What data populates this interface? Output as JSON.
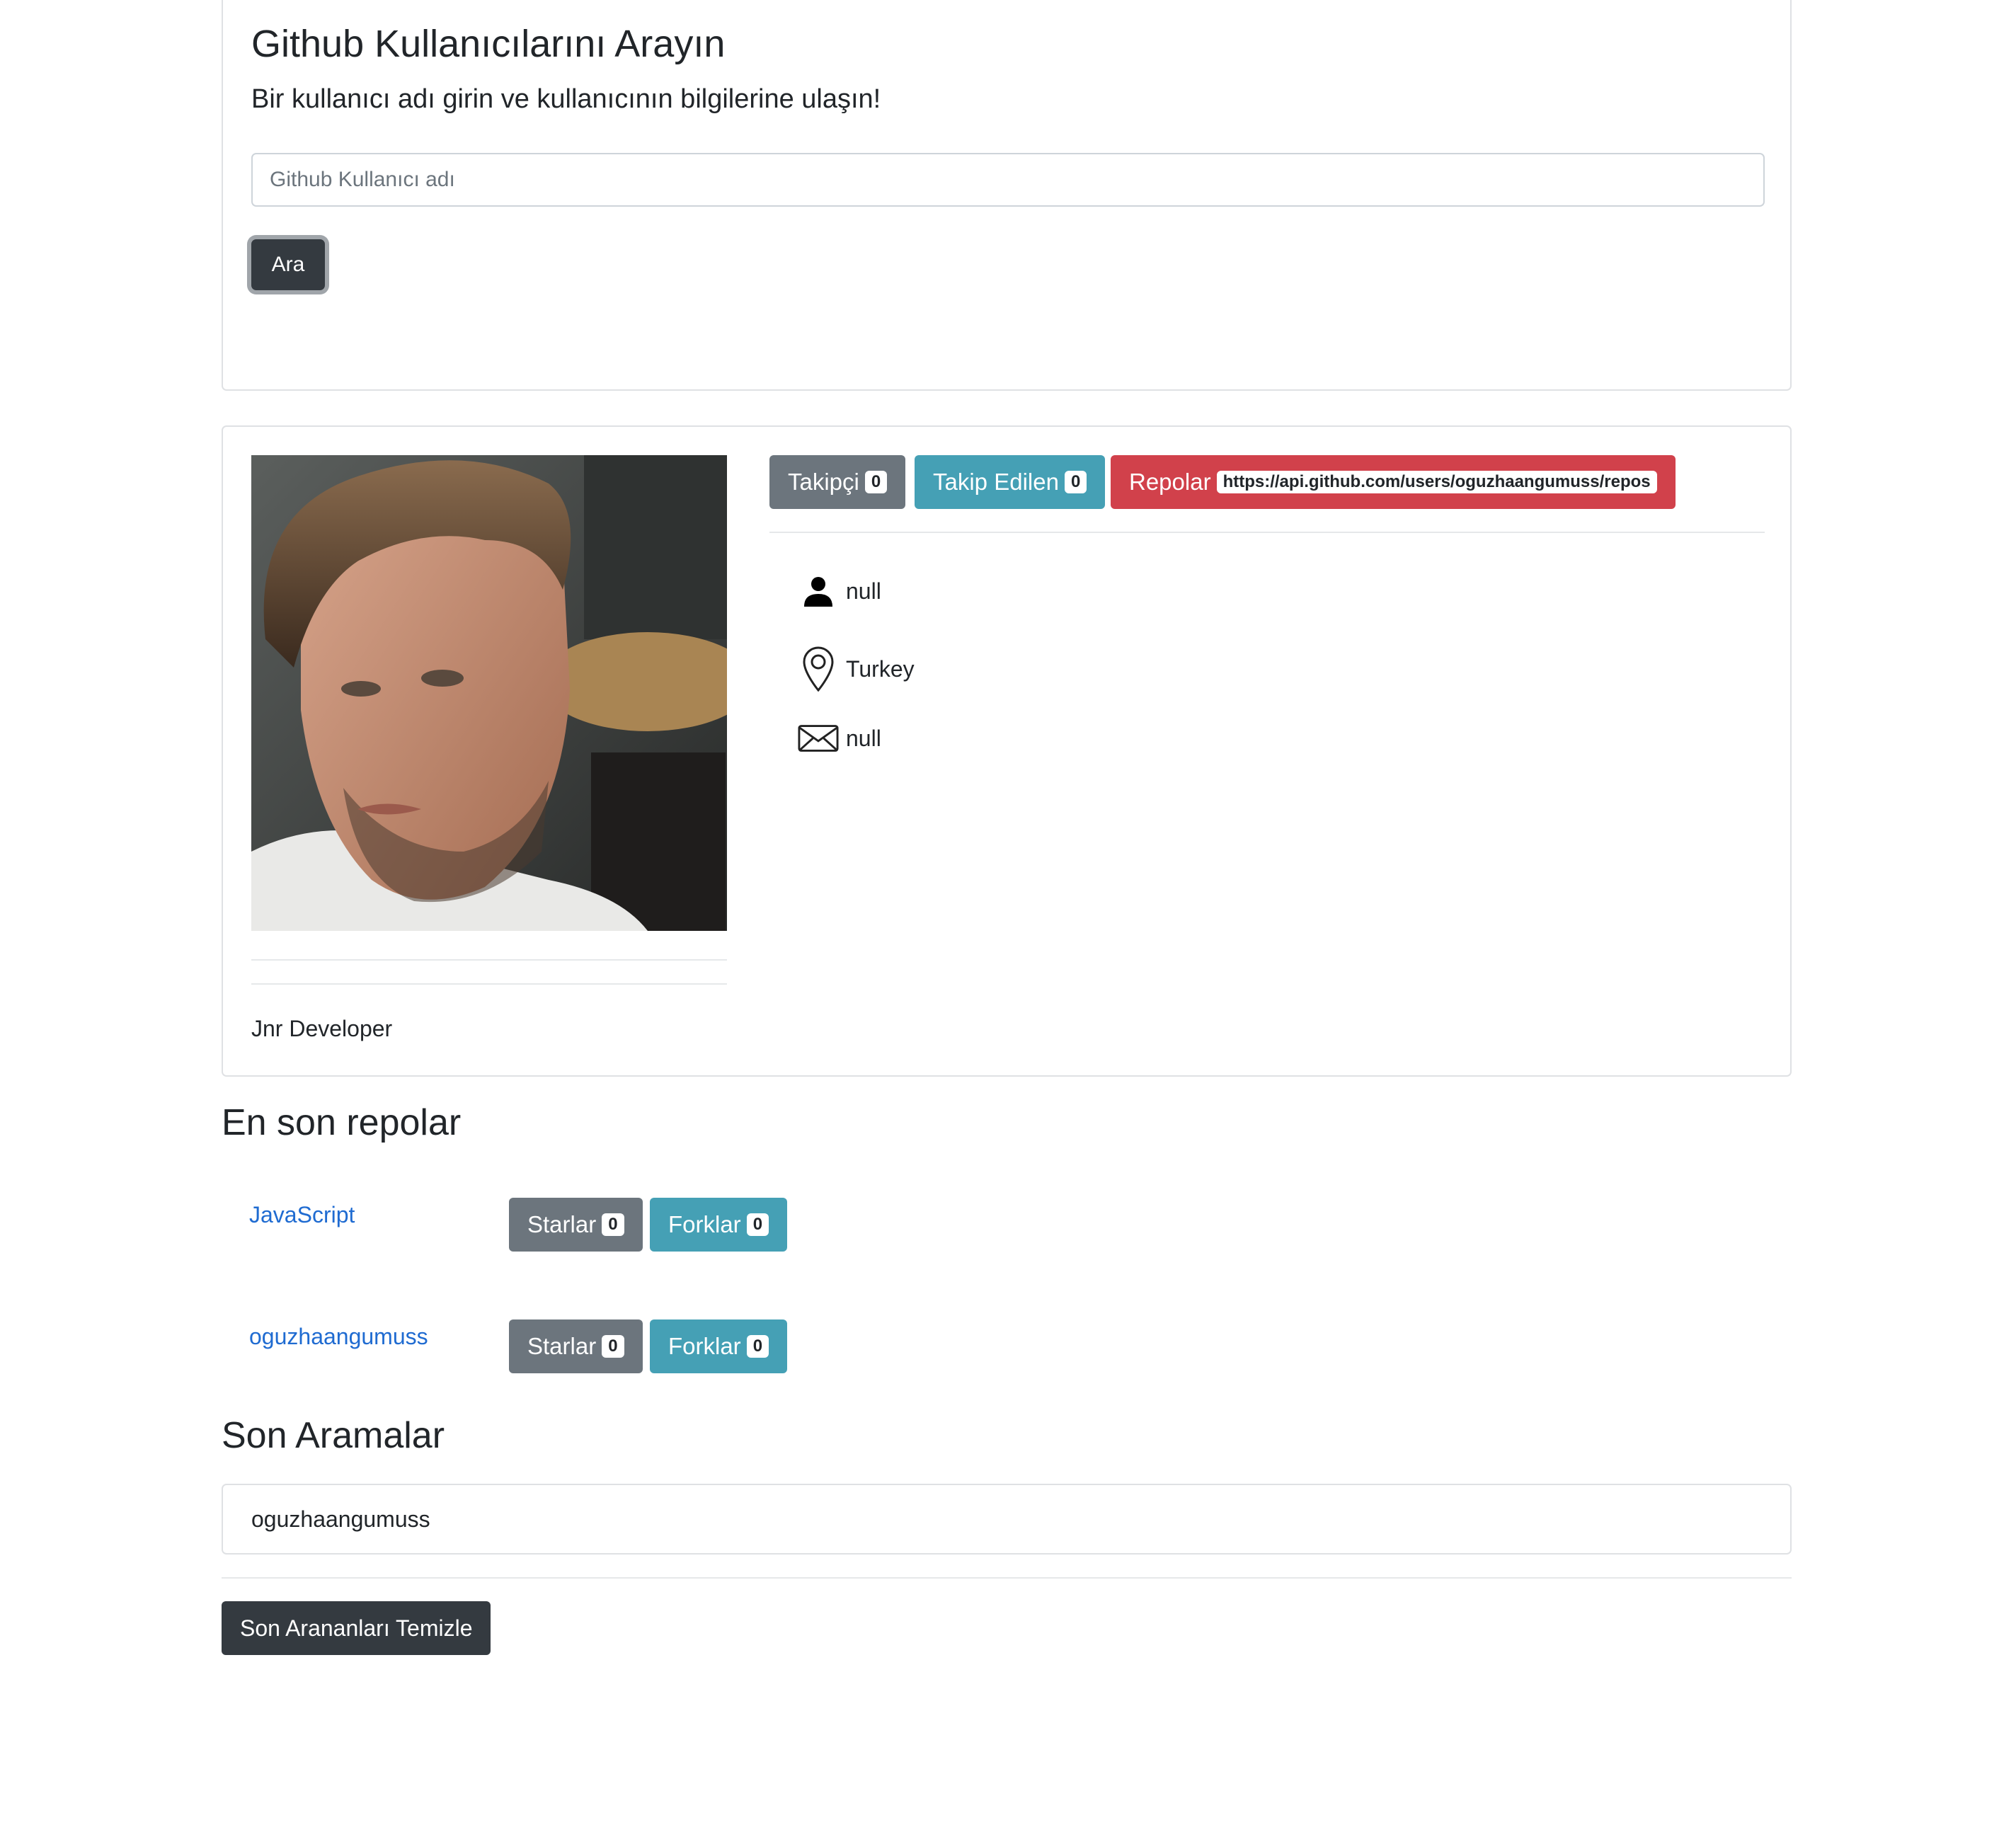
{
  "search": {
    "title": "Github Kullanıcılarını Arayın",
    "subtitle": "Bir kullanıcı adı girin ve kullanıcının bilgilerine ulaşın!",
    "placeholder": "Github Kullanıcı adı",
    "value": "",
    "button_label": "Ara"
  },
  "profile": {
    "bio": "Jnr Developer",
    "stats": {
      "followers_label": "Takipçi",
      "followers_count": "0",
      "following_label": "Takip Edilen",
      "following_count": "0",
      "repos_label": "Repolar",
      "repos_url": "https://api.github.com/users/oguzhaangumuss/repos"
    },
    "name": "null",
    "location": "Turkey",
    "email": "null",
    "icons": [
      "person-icon",
      "location-pin-icon",
      "envelope-icon"
    ]
  },
  "repos": {
    "heading": "En son repolar",
    "items": [
      {
        "name": "JavaScript",
        "stars_label": "Starlar",
        "stars": "0",
        "forks_label": "Forklar",
        "forks": "0"
      },
      {
        "name": "oguzhaangumuss",
        "stars_label": "Starlar",
        "stars": "0",
        "forks_label": "Forklar",
        "forks": "0"
      }
    ]
  },
  "recent": {
    "heading": "Son Aramalar",
    "items": [
      "oguzhaangumuss"
    ],
    "clear_label": "Son Arananları Temizle"
  },
  "colors": {
    "dark": "#343a40",
    "secondary": "#6c757d",
    "info": "#45a0b5",
    "danger": "#d1414b",
    "link": "#1f6bd1"
  }
}
